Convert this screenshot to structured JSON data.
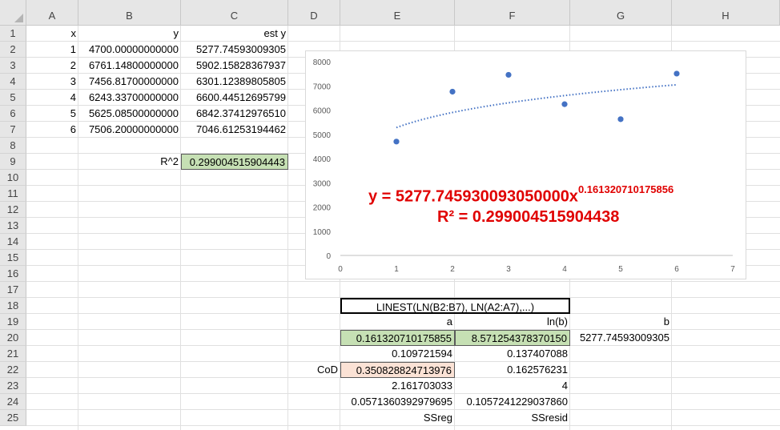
{
  "columns": [
    "A",
    "B",
    "C",
    "D",
    "E",
    "F",
    "G",
    "H"
  ],
  "rows": [
    "1",
    "2",
    "3",
    "4",
    "5",
    "6",
    "7",
    "8",
    "9",
    "10",
    "11",
    "12",
    "13",
    "14",
    "15",
    "16",
    "17",
    "18",
    "19",
    "20",
    "21",
    "22",
    "23",
    "24",
    "25"
  ],
  "cells": {
    "A1": "x",
    "B1": "y",
    "C1": "est y",
    "A2": "1",
    "B2": "4700.00000000000",
    "C2": "5277.74593009305",
    "A3": "2",
    "B3": "6761.14800000000",
    "C3": "5902.15828367937",
    "A4": "3",
    "B4": "7456.81700000000",
    "C4": "6301.12389805805",
    "A5": "4",
    "B5": "6243.33700000000",
    "C5": "6600.44512695799",
    "A6": "5",
    "B6": "5625.08500000000",
    "C6": "6842.37412976510",
    "A7": "6",
    "B7": "7506.20000000000",
    "C7": "7046.61253194462",
    "B9": "R^2",
    "C9": "0.299004515904443",
    "E18": "LINEST(LN(B2:B7), LN(A2:A7),...)",
    "E19": "a",
    "F19": "ln(b)",
    "G19": "b",
    "E20": "0.161320710175855",
    "F20": "8.571254378370150",
    "G20": "5277.74593009305",
    "E21": "0.109721594",
    "F21": "0.137407088",
    "D22": "CoD",
    "E22": "0.350828824713976",
    "F22": "0.162576231",
    "E23": "2.161703033",
    "F23": "4",
    "E24": "0.0571360392979695",
    "F24": "0.1057241229037860",
    "E25": "SSreg",
    "F25": "SSresid"
  },
  "colors": {
    "green_fill": "#c6e0b4",
    "peach_fill": "#fbe2d5",
    "series": "#4472c4",
    "trendline_label": "#e00000"
  },
  "chart_data": {
    "type": "scatter",
    "x": [
      1,
      2,
      3,
      4,
      5,
      6
    ],
    "y": [
      4700,
      6761.148,
      7456.817,
      6243.337,
      5625.085,
      7506.2
    ],
    "trendline": {
      "type": "power",
      "coefficient": 5277.74593009305,
      "exponent": 0.161320710175856,
      "x_range": [
        1,
        6
      ],
      "style": "dotted",
      "equation_base": "y = 5277.745930093050000x",
      "equation_exponent": "0.161320710175856",
      "r2_label": "R² = 0.299004515904438"
    },
    "xlim": [
      0,
      7
    ],
    "ylim": [
      0,
      8000
    ],
    "x_ticks": [
      "0",
      "1",
      "2",
      "3",
      "4",
      "5",
      "6",
      "7"
    ],
    "y_ticks": [
      "0",
      "1000",
      "2000",
      "3000",
      "4000",
      "5000",
      "6000",
      "7000",
      "8000"
    ],
    "grid": "none",
    "legend": "none"
  }
}
